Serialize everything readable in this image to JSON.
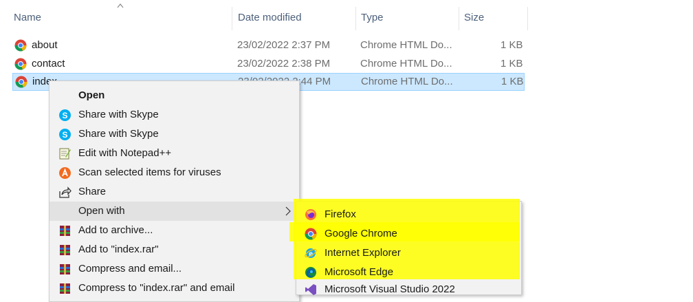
{
  "columns": {
    "name": "Name",
    "date": "Date modified",
    "type": "Type",
    "size": "Size"
  },
  "files": [
    {
      "name": "about",
      "date": "23/02/2022 2:37 PM",
      "type": "Chrome HTML Do...",
      "size": "1 KB"
    },
    {
      "name": "contact",
      "date": "23/02/2022 2:38 PM",
      "type": "Chrome HTML Do...",
      "size": "1 KB"
    },
    {
      "name": "index",
      "date": "23/02/2022 2:44 PM",
      "type": "Chrome HTML Do...",
      "size": "1 KB",
      "selected": true
    }
  ],
  "context_menu": {
    "items": [
      {
        "label": "Open",
        "icon": "none",
        "bold": true
      },
      {
        "label": "Share with Skype",
        "icon": "skype-icon"
      },
      {
        "label": "Share with Skype",
        "icon": "skype-icon"
      },
      {
        "label": "Edit with Notepad++",
        "icon": "notepad-plus-plus-icon"
      },
      {
        "label": "Scan selected items for viruses",
        "icon": "avast-icon"
      },
      {
        "label": "Share",
        "icon": "share-icon"
      },
      {
        "label": "Open with",
        "icon": "none",
        "has_submenu": true
      },
      {
        "label": "Add to archive...",
        "icon": "winrar-icon"
      },
      {
        "label": "Add to \"index.rar\"",
        "icon": "winrar-icon"
      },
      {
        "label": "Compress and email...",
        "icon": "winrar-icon"
      },
      {
        "label": "Compress to \"index.rar\" and email",
        "icon": "winrar-icon"
      }
    ]
  },
  "open_with_submenu": {
    "items": [
      {
        "label": "Firefox",
        "icon": "firefox-icon"
      },
      {
        "label": "Google Chrome",
        "icon": "chrome-icon"
      },
      {
        "label": "Internet Explorer",
        "icon": "internet-explorer-icon"
      },
      {
        "label": "Microsoft Edge",
        "icon": "edge-icon"
      },
      {
        "label": "Microsoft Visual Studio 2022",
        "icon": "visual-studio-icon"
      }
    ],
    "highlight_color": "#ffff00"
  },
  "colors": {
    "selection_bg": "#cce8ff",
    "selection_border": "#99d1ff",
    "header_text": "#4c607a",
    "menu_bg": "#f2f2f2"
  }
}
